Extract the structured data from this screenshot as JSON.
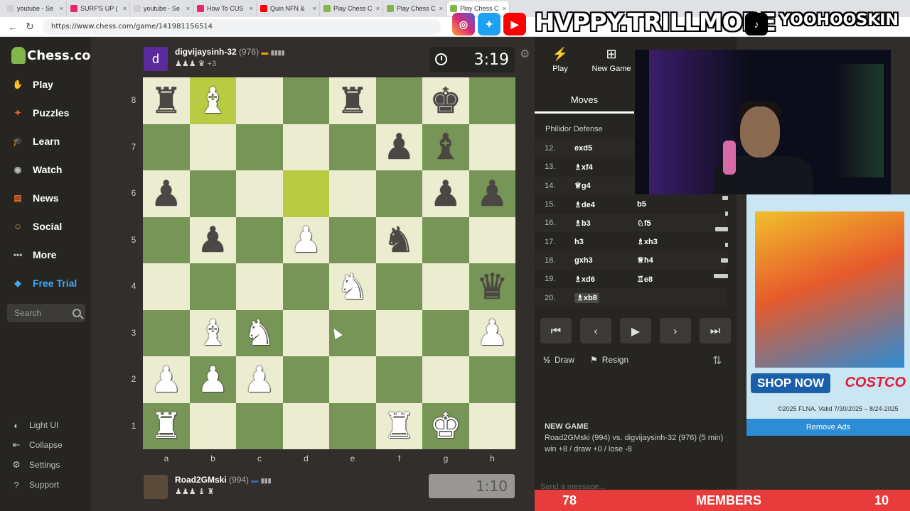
{
  "browser": {
    "tabs": [
      {
        "label": "youtube - Se",
        "color": "#d0d0d0"
      },
      {
        "label": "SURF'S UP (",
        "color": "#e8266a"
      },
      {
        "label": "youtube - Se",
        "color": "#d0d0d0"
      },
      {
        "label": "How To CUS",
        "color": "#e8266a"
      },
      {
        "label": "Quin NFN &",
        "color": "#ff0000"
      },
      {
        "label": "Play Chess C",
        "color": "#81b64c"
      },
      {
        "label": "Play Chess C",
        "color": "#81b64c"
      },
      {
        "label": "Play Chess C",
        "color": "#81b64c"
      }
    ],
    "url": "https://www.chess.com/game/141981156514"
  },
  "overlay": {
    "brand": "HVPPY.TRILLMORE",
    "tag": "YOOHOOSKIN"
  },
  "sidebar": {
    "logo": "Chess.com",
    "items": [
      {
        "label": "Play",
        "icon": "play-hand-icon"
      },
      {
        "label": "Puzzles",
        "icon": "puzzle-icon"
      },
      {
        "label": "Learn",
        "icon": "learn-icon"
      },
      {
        "label": "Watch",
        "icon": "binoculars-icon"
      },
      {
        "label": "News",
        "icon": "news-icon"
      },
      {
        "label": "Social",
        "icon": "social-icon"
      },
      {
        "label": "More",
        "icon": "more-dots-icon"
      },
      {
        "label": "Free Trial",
        "icon": "diamond-icon"
      }
    ],
    "search_placeholder": "Search",
    "bottom": [
      {
        "label": "Light UI"
      },
      {
        "label": "Collapse"
      },
      {
        "label": "Settings"
      },
      {
        "label": "Support"
      }
    ]
  },
  "top_player": {
    "avatar_letter": "d",
    "name": "digvijaysinh-32",
    "rating": "(976)",
    "captured": "♟♟♟ ♛",
    "advantage": "+3",
    "clock": "3:19"
  },
  "bottom_player": {
    "name": "Road2GMski",
    "rating": "(994)",
    "captured": "♟♟♟ ♝ ♜",
    "clock": "1:10"
  },
  "board": {
    "ranks": [
      "8",
      "7",
      "6",
      "5",
      "4",
      "3",
      "2",
      "1"
    ],
    "files": [
      "a",
      "b",
      "c",
      "d",
      "e",
      "f",
      "g",
      "h"
    ],
    "highlights": [
      "b8",
      "d6"
    ],
    "pieces": [
      {
        "sq": "a8",
        "p": "♜",
        "c": "b"
      },
      {
        "sq": "b8",
        "p": "♝",
        "c": "w"
      },
      {
        "sq": "e8",
        "p": "♜",
        "c": "b"
      },
      {
        "sq": "g8",
        "p": "♚",
        "c": "b"
      },
      {
        "sq": "f7",
        "p": "♟",
        "c": "b"
      },
      {
        "sq": "g7",
        "p": "♝",
        "c": "b"
      },
      {
        "sq": "a6",
        "p": "♟",
        "c": "b"
      },
      {
        "sq": "g6",
        "p": "♟",
        "c": "b"
      },
      {
        "sq": "h6",
        "p": "♟",
        "c": "b"
      },
      {
        "sq": "b5",
        "p": "♟",
        "c": "b"
      },
      {
        "sq": "d5",
        "p": "♟",
        "c": "w"
      },
      {
        "sq": "f5",
        "p": "♞",
        "c": "b"
      },
      {
        "sq": "e4",
        "p": "♞",
        "c": "w"
      },
      {
        "sq": "h4",
        "p": "♛",
        "c": "b"
      },
      {
        "sq": "b3",
        "p": "♝",
        "c": "w"
      },
      {
        "sq": "c3",
        "p": "♞",
        "c": "w"
      },
      {
        "sq": "h3",
        "p": "♟",
        "c": "w"
      },
      {
        "sq": "a2",
        "p": "♟",
        "c": "w"
      },
      {
        "sq": "b2",
        "p": "♟",
        "c": "w"
      },
      {
        "sq": "c2",
        "p": "♟",
        "c": "w"
      },
      {
        "sq": "a1",
        "p": "♜",
        "c": "w"
      },
      {
        "sq": "f1",
        "p": "♜",
        "c": "w"
      },
      {
        "sq": "g1",
        "p": "♚",
        "c": "w"
      }
    ]
  },
  "panel": {
    "tab_play": "Play",
    "tab_new": "New Game",
    "tab_moves": "Moves",
    "opening": "Philidor Defense",
    "moves": [
      {
        "n": "12.",
        "w": "exd5",
        "b": ""
      },
      {
        "n": "13.",
        "w": "♗xf4",
        "b": ""
      },
      {
        "n": "14.",
        "w": "♕g4",
        "b": ""
      },
      {
        "n": "15.",
        "w": "♗de4",
        "b": "b5"
      },
      {
        "n": "16.",
        "w": "♗b3",
        "b": "♘f5"
      },
      {
        "n": "17.",
        "w": "h3",
        "b": "♗xh3"
      },
      {
        "n": "18.",
        "w": "gxh3",
        "b": "♕h4"
      },
      {
        "n": "19.",
        "w": "♗xd6",
        "b": "♖e8"
      },
      {
        "n": "20.",
        "w": "♗xb8",
        "b": ""
      }
    ],
    "draw": "Draw",
    "draw_icon": "½",
    "resign": "Resign",
    "newgame_title": "NEW GAME",
    "newgame_desc": "Road2GMski (994) vs. digvijaysinh-32 (976) (5 min)",
    "newgame_stakes": "win +8 / draw +0 / lose -8",
    "message_placeholder": "Send a message..."
  },
  "ad": {
    "shop": "SHOP NOW",
    "brand": "COSTCO",
    "fine": "©2025 FLNA. Valid 7/30/2025 – 8/24-2025",
    "remove": "Remove Ads"
  },
  "members": {
    "left": "78",
    "label": "MEMBERS",
    "right": "10"
  }
}
